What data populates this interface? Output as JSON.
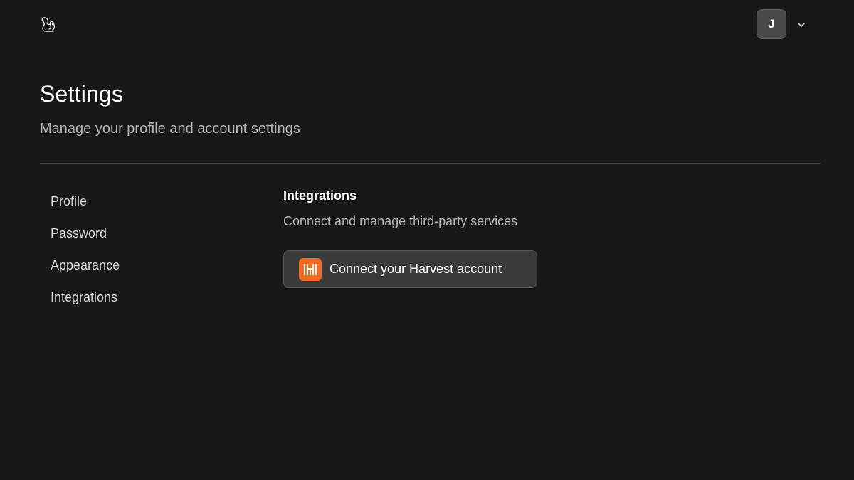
{
  "header": {
    "logo_icon": "squirrel-logo-icon",
    "avatar_initial": "J",
    "menu_icon": "chevron-down-icon"
  },
  "page": {
    "title": "Settings",
    "subtitle": "Manage your profile and account settings"
  },
  "sidebar": {
    "items": [
      {
        "label": "Profile"
      },
      {
        "label": "Password"
      },
      {
        "label": "Appearance"
      },
      {
        "label": "Integrations"
      }
    ]
  },
  "integrations": {
    "title": "Integrations",
    "description": "Connect and manage third-party services",
    "harvest_button": {
      "label": "Connect your Harvest account",
      "icon": "harvest-icon",
      "icon_color": "#f36c21"
    }
  },
  "colors": {
    "background": "#181818",
    "button_bg": "#3a3a3a",
    "avatar_bg": "#4a4a4a",
    "muted_text": "#b5b5b5",
    "accent": "#f36c21"
  }
}
